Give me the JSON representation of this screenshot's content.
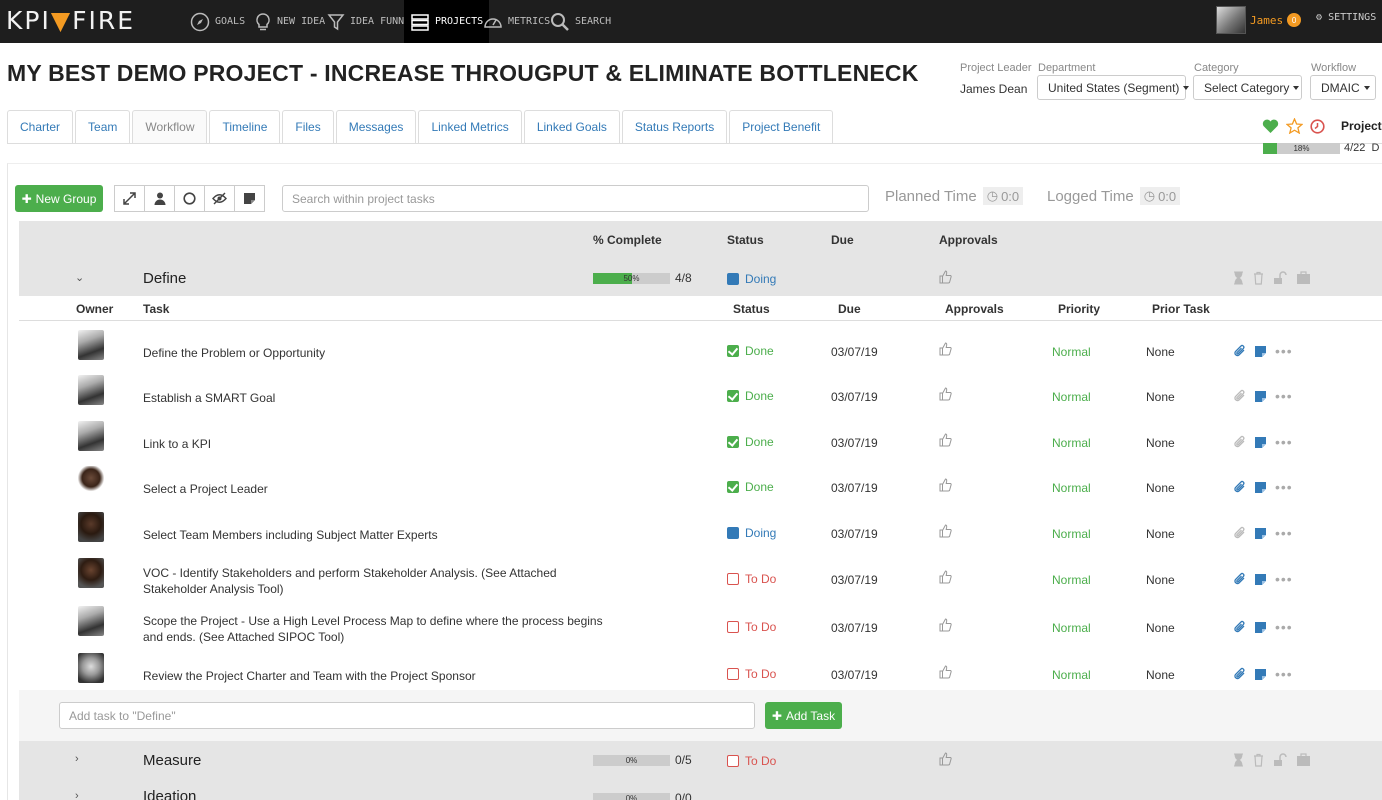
{
  "nav": {
    "logo_left": "KPI",
    "logo_right": "FIRE",
    "items": [
      {
        "label": "GOALS",
        "icon": "compass-icon"
      },
      {
        "label": "NEW IDEA",
        "icon": "lightbulb-icon"
      },
      {
        "label": "IDEA FUNNEL",
        "icon": "funnel-icon"
      },
      {
        "label": "PROJECTS",
        "icon": "projects-icon",
        "active": true
      },
      {
        "label": "METRICS",
        "icon": "gauge-icon"
      },
      {
        "label": "SEARCH",
        "icon": "search-icon"
      }
    ],
    "user_name": "James",
    "user_badge": "0",
    "settings_label": "SETTINGS"
  },
  "header": {
    "title": "MY BEST DEMO PROJECT - INCREASE THROUGPUT & ELIMINATE BOTTLENECK",
    "project_leader_label": "Project Leader",
    "project_leader": "James Dean",
    "department_label": "Department",
    "department_value": "United States (Segment)",
    "category_label": "Category",
    "category_value": "Select Category",
    "workflow_label": "Workflow",
    "workflow_value": "DMAIC",
    "project_label": "Project I",
    "progress_pct": "18%",
    "progress_fraction": 0.18,
    "progress_count": "4/22",
    "progress_suffix": "D"
  },
  "tabs": [
    "Charter",
    "Team",
    "Workflow",
    "Timeline",
    "Files",
    "Messages",
    "Linked Metrics",
    "Linked Goals",
    "Status Reports",
    "Project Benefit"
  ],
  "active_tab": "Workflow",
  "toolbar": {
    "new_group_label": "New Group",
    "search_placeholder": "Search within project tasks",
    "planned_time_label": "Planned Time",
    "planned_time_value": "0:0",
    "logged_time_label": "Logged Time",
    "logged_time_value": "0:0"
  },
  "group_columns": {
    "complete": "% Complete",
    "status": "Status",
    "due": "Due",
    "approvals": "Approvals"
  },
  "task_columns": {
    "owner": "Owner",
    "task": "Task",
    "status": "Status",
    "due": "Due",
    "approvals": "Approvals",
    "priority": "Priority",
    "prior_task": "Prior Task"
  },
  "groups": [
    {
      "name": "Define",
      "pct_label": "50%",
      "pct": 0.5,
      "count": "4/8",
      "status": "Doing"
    },
    {
      "name": "Measure",
      "pct_label": "0%",
      "pct": 0,
      "count": "0/5",
      "status": "To Do"
    },
    {
      "name": "Ideation",
      "pct_label": "0%",
      "pct": 0,
      "count": "0/0",
      "status": ""
    }
  ],
  "tasks": [
    {
      "task": "Define the Problem or Opportunity",
      "status": "Done",
      "due": "03/07/19",
      "priority": "Normal",
      "prior": "None"
    },
    {
      "task": "Establish a SMART Goal",
      "status": "Done",
      "due": "03/07/19",
      "priority": "Normal",
      "prior": "None"
    },
    {
      "task": "Link to a KPI",
      "status": "Done",
      "due": "03/07/19",
      "priority": "Normal",
      "prior": "None"
    },
    {
      "task": "Select a Project Leader",
      "status": "Done",
      "due": "03/07/19",
      "priority": "Normal",
      "prior": "None"
    },
    {
      "task": "Select Team Members including Subject Matter Experts",
      "status": "Doing",
      "due": "03/07/19",
      "priority": "Normal",
      "prior": "None"
    },
    {
      "task": "VOC - Identify Stakeholders and perform Stakeholder Analysis. (See Attached Stakeholder Analysis Tool)",
      "status": "To Do",
      "due": "03/07/19",
      "priority": "Normal",
      "prior": "None"
    },
    {
      "task": "Scope the Project - Use a High Level Process Map to define where the process begins and ends. (See Attached SIPOC Tool)",
      "status": "To Do",
      "due": "03/07/19",
      "priority": "Normal",
      "prior": "None"
    },
    {
      "task": "Review the Project Charter and Team with the Project Sponsor",
      "status": "To Do",
      "due": "03/07/19",
      "priority": "Normal",
      "prior": "None"
    }
  ],
  "add_task": {
    "placeholder": "Add task to \"Define\"",
    "button_label": "Add Task"
  },
  "colors": {
    "green": "#4cae4c",
    "blue": "#337ab7",
    "red": "#d9534f",
    "orange": "#f39a22"
  }
}
